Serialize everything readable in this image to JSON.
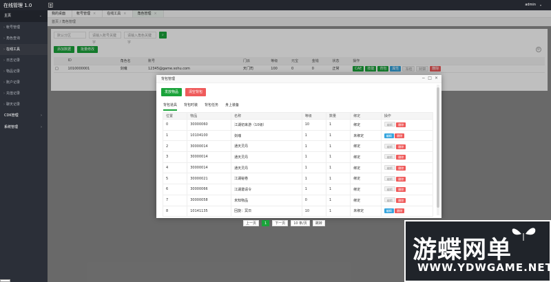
{
  "app": {
    "title": "在线管理 1.0",
    "user": "admin"
  },
  "sidebar": {
    "home": "主页",
    "items": [
      "帐号管理",
      "角色查询",
      "在线工具",
      "日志记录",
      "物品记录",
      "账户记录",
      "充值记录",
      "聊天记录"
    ],
    "groups": [
      "CDK管理",
      "系统管理"
    ]
  },
  "tabs": [
    {
      "label": "我的桌面"
    },
    {
      "label": "帐号管理"
    },
    {
      "label": "在线工具"
    },
    {
      "label": "角色管理"
    }
  ],
  "breadcrumb": "首页 / 角色管理",
  "search": {
    "zone_value": "默认分区",
    "account_placeholder": "请输入账号关键字",
    "role_placeholder": "请输入角色关键字"
  },
  "toolbar": {
    "add_label": "添加数据",
    "edit_label": "批量修改"
  },
  "main_table": {
    "headers": [
      "",
      "ID",
      "角色名",
      "账号",
      "门派",
      "等级",
      "元宝",
      "金钱",
      "状态",
      "操作"
    ],
    "row": [
      "",
      "1010000001",
      "剑魂",
      "12345@game.sohu.com",
      "天门司",
      "100",
      "0",
      "0",
      "正常"
    ],
    "ops": [
      "CAE",
      "技能",
      "背包",
      "属性",
      "冻结",
      "封禁",
      "删除"
    ]
  },
  "modal": {
    "title": "背包管理",
    "add_label": "发放物品",
    "clear_label": "清空背包",
    "tabs": [
      "背包道具",
      "背包时装",
      "背包任务",
      "身上装备"
    ],
    "table_headers": [
      "位置",
      "物品",
      "名称",
      "等级",
      "数量",
      "绑定",
      "操作"
    ],
    "rows": [
      [
        "0",
        "30000060",
        "江湖初来游（10级）",
        "10",
        "1",
        "绑定"
      ],
      [
        "1",
        "10104100",
        "剑魂",
        "1",
        "1",
        "未绑定"
      ],
      [
        "2",
        "30000014",
        "通天灵丹",
        "1",
        "1",
        "绑定"
      ],
      [
        "3",
        "30000014",
        "通天灵丹",
        "1",
        "1",
        "绑定"
      ],
      [
        "4",
        "30000014",
        "通天灵丹",
        "1",
        "1",
        "绑定"
      ],
      [
        "5",
        "30000021",
        "江湖秘卷",
        "1",
        "1",
        "绑定"
      ],
      [
        "6",
        "30000066",
        "江湖邀请令",
        "1",
        "1",
        "绑定"
      ],
      [
        "7",
        "30000058",
        "未知物品",
        "0",
        "1",
        "绑定"
      ],
      [
        "8",
        "10141135",
        "回旋：冥日",
        "10",
        "1",
        "未绑定"
      ]
    ],
    "edit_label": "编辑",
    "delete_label": "删除",
    "pager": {
      "prev": "上一页",
      "page": "1",
      "next": "下一页",
      "size": "10 条/页",
      "jump": "跳转"
    }
  },
  "watermark": {
    "line1": "游蝶网单",
    "line2": "WWW.YDWGAME.NET"
  }
}
